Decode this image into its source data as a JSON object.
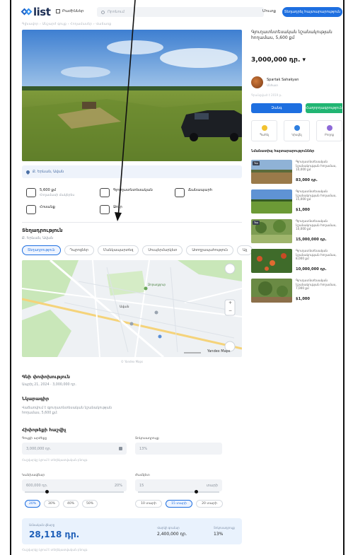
{
  "header": {
    "logo_text": "list",
    "categories_label": "Բաժիններ",
    "search_placeholder": "Որոնում",
    "login_label": "Մուտք",
    "post_ad_label": "Տեղադրել հայտարարություն"
  },
  "breadcrumb": "Գլխավոր › Անշարժ գույք › Հողամասեր › Վաճառք",
  "listing": {
    "location_chip": "Ք. Երևան, Ավան",
    "features": [
      {
        "value": "5,600 քմ",
        "label": "Հողամասի մակերես"
      },
      {
        "value": "Գյուղատնտեսական",
        "label": ""
      },
      {
        "value": "Ճանապարհ",
        "label": ""
      },
      {
        "value": "Հոսանք",
        "label": ""
      },
      {
        "value": "Ջուր",
        "label": ""
      }
    ],
    "location_title": "Տեղադրություն",
    "location_sub": "Ք. Երևան, Ավան",
    "poi_tabs": [
      "Տեղադրություն",
      "Դպրոցներ",
      "Մանկապարտեզ",
      "Սուպերմարկետ",
      "Առողջապահություն",
      "Այլ"
    ],
    "map_labels": [
      "Ավան",
      "Ձորաղբյուր"
    ],
    "map_credit": "© Yandex Maps",
    "map_brand": "Yandex Maps",
    "price_history_title": "Գնի փոփոխություն",
    "price_history_text": "Ապրիլ 21, 2024 · 3,000,000 դր.",
    "description_title": "Նկարագիր",
    "description_text": "Վաճառվում է գյուղատնտեսական նշանակության հողամաս, 5,600 քմ:",
    "calculator_title": "Հիփոթեքի հաշվիչ"
  },
  "calculator": {
    "price_label": "Գույքի արժեքը",
    "price_value": "3,000,000 դր.",
    "rate_label": "Տոկոսադրույք",
    "rate_value": "13%",
    "downpayment_label": "Կանխավճար",
    "downpayment_value": "600,000 դր.",
    "downpayment_percent": "20%",
    "term_label": "Ժամկետ",
    "term_value": "15",
    "term_unit": "տարի",
    "down_options": [
      "20%",
      "30%",
      "40%",
      "50%"
    ],
    "term_options": [
      "10 տարի",
      "15 տարի",
      "20 տարի"
    ],
    "monthly_label": "Ամսական վճարը",
    "monthly_value": "28,118 դր.",
    "loan_label": "Վարկի գումար",
    "loan_value": "2,400,000 դր.",
    "rate2_label": "Տոկոսադրույք",
    "rate2_value": "13%",
    "note": "Հաշվարկը կրում է տեղեկատվական բնույթ"
  },
  "sidebar": {
    "title": "Գյուղատնտեսական նշանակության հողամաս, 5,600 քմ",
    "price": "3,000,000 դր. ▾",
    "seller_name": "Spartak Sahakyan",
    "seller_sub": "Անհատ",
    "seller_meta": "Գրանցված է 2019 թ.",
    "call_label": "Զանգ",
    "message_label": "Հաղորդագրություն",
    "actions": [
      "Պահել",
      "Կիսվել",
      "Բողոք"
    ],
    "similar_title": "Նմանատիպ հայտարարություններ",
    "similar": [
      {
        "tag": "Top",
        "title": "Գյուղատնտեսական նշանակության հողամաս, 10,000 քմ",
        "price": "83,000 դր."
      },
      {
        "tag": "",
        "title": "Գյուղատնտեսական նշանակության հողամաս, 15,000 քմ",
        "price": "$1,000"
      },
      {
        "tag": "Top",
        "title": "Գյուղատնտեսական նշանակության հողամաս, 10,000 քմ",
        "price": "15,000,000 դր."
      },
      {
        "tag": "",
        "title": "Գյուղատնտեսական նշանակության հողամաս, 8,000 քմ",
        "price": "10,000,000 դր."
      },
      {
        "tag": "",
        "title": "Գյուղատնտեսական նշանակության հողամաս, 7,000 քմ",
        "price": "$1,000"
      }
    ]
  },
  "colors": {
    "accent": "#1e6fe0",
    "green": "#21b573"
  }
}
